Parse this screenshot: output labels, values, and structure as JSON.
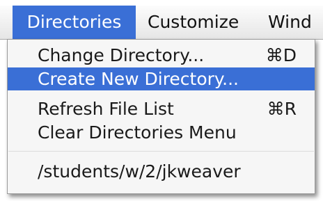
{
  "menubar": {
    "titles": [
      "Directories",
      "Customize",
      "Wind"
    ]
  },
  "dropdown": {
    "items": [
      {
        "label": "Change Directory...",
        "shortcut": "⌘D"
      },
      {
        "label": "Create New Directory...",
        "shortcut": ""
      },
      {
        "label": "Refresh File List",
        "shortcut": "⌘R"
      },
      {
        "label": "Clear Directories Menu",
        "shortcut": ""
      }
    ],
    "path": "/students/w/2/jkweaver"
  },
  "colors": {
    "highlight": "#3a6fd6",
    "menu_background": "#f6f6f6"
  }
}
